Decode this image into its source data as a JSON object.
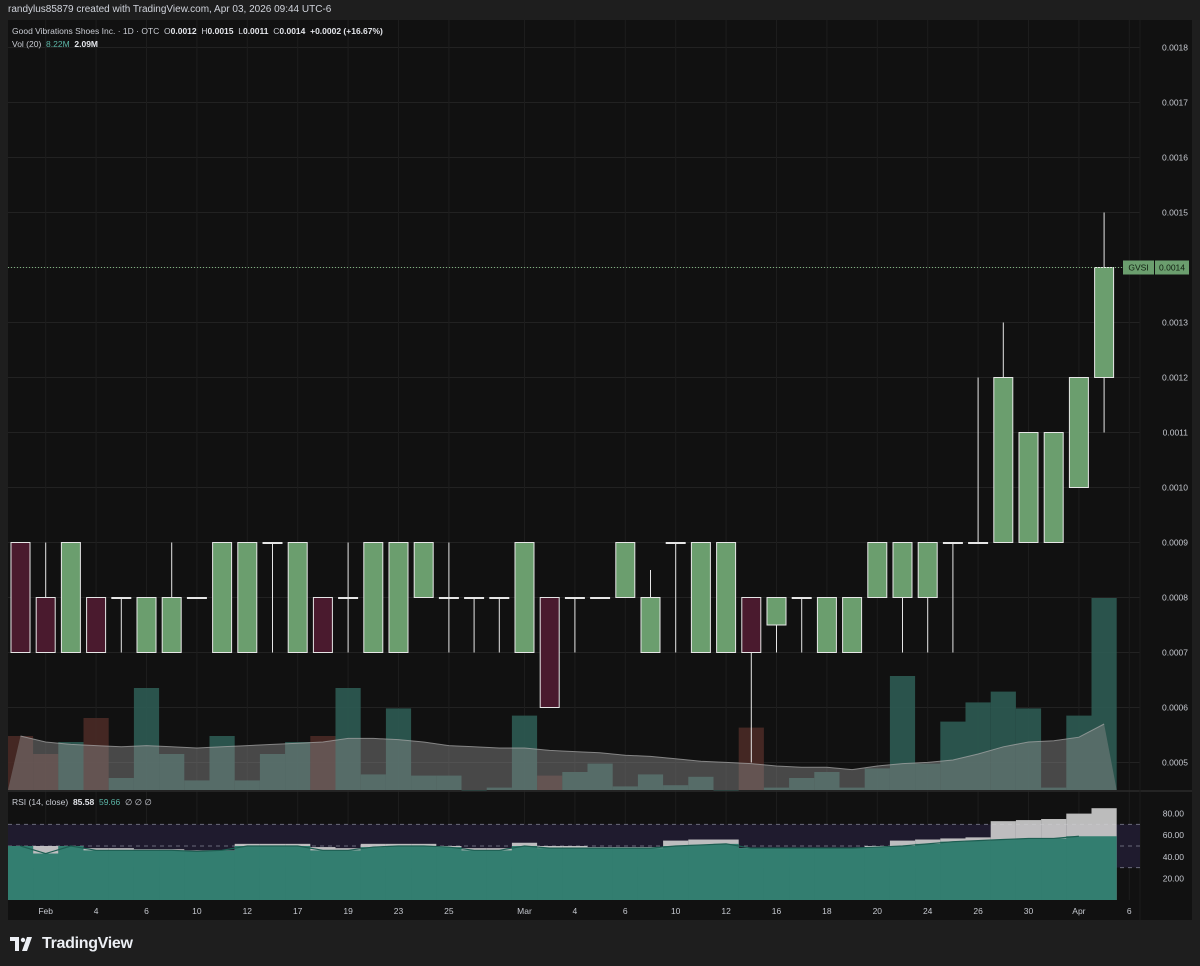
{
  "header": {
    "attribution": "randylus85879 created with TradingView.com, Apr 03, 2026 09:44 UTC-6"
  },
  "legend": {
    "symbol": "Good Vibrations Shoes Inc.",
    "interval_exchange": "· 1D · OTC",
    "o_label": "O",
    "o_value": "0.0012",
    "h_label": "H",
    "h_value": "0.0015",
    "l_label": "L",
    "l_value": "0.0011",
    "c_label": "C",
    "c_value": "0.0014",
    "change": "+0.0002 (+16.67%)",
    "vol_label": "Vol (20)",
    "vol_value_1": "8.22M",
    "vol_value_2": "2.09M",
    "rsi_label": "RSI (14, close)",
    "rsi_value": "85.58",
    "rsi_ma_value": "59.66",
    "rsi_extra": "∅ ∅ ∅"
  },
  "price_tag": {
    "ticker": "GVSI",
    "value": "0.0014"
  },
  "footer": {
    "brand": "TradingView"
  },
  "colors": {
    "up": "#6b9e6e",
    "down": "#4a1a2e",
    "vol_up": "#2e5b53",
    "vol_down": "#4a2a26",
    "vol_ma": "#8c8c8c",
    "rsi_fill": "#2b7a6b",
    "rsi_band": "#1f1b2e",
    "background": "#111111"
  },
  "chart_data": {
    "type": "candlestick",
    "y_axis_price": {
      "min": 0.00045,
      "max": 0.00185,
      "ticks": [
        "0.0018",
        "0.0017",
        "0.0016",
        "0.0015",
        "0.0014",
        "0.0013",
        "0.0012",
        "0.0011",
        "0.0010",
        "0.0009",
        "0.0008",
        "0.0007",
        "0.0006",
        "0.0005"
      ]
    },
    "y_axis_rsi": {
      "min": 0,
      "max": 100,
      "ticks": [
        "80.00",
        "60.00",
        "40.00",
        "20.00"
      ],
      "band": [
        30,
        70
      ],
      "midline": 50
    },
    "x_tick_labels": [
      {
        "i": 1,
        "label": "Feb"
      },
      {
        "i": 3,
        "label": "4"
      },
      {
        "i": 5,
        "label": "6"
      },
      {
        "i": 7,
        "label": "10"
      },
      {
        "i": 9,
        "label": "12"
      },
      {
        "i": 11,
        "label": "17"
      },
      {
        "i": 13,
        "label": "19"
      },
      {
        "i": 15,
        "label": "23"
      },
      {
        "i": 17,
        "label": "25"
      },
      {
        "i": 20,
        "label": "Mar"
      },
      {
        "i": 22,
        "label": "4"
      },
      {
        "i": 24,
        "label": "6"
      },
      {
        "i": 26,
        "label": "10"
      },
      {
        "i": 28,
        "label": "12"
      },
      {
        "i": 30,
        "label": "16"
      },
      {
        "i": 32,
        "label": "18"
      },
      {
        "i": 34,
        "label": "20"
      },
      {
        "i": 36,
        "label": "24"
      },
      {
        "i": 38,
        "label": "26"
      },
      {
        "i": 40,
        "label": "30"
      },
      {
        "i": 42,
        "label": "Apr"
      },
      {
        "i": 44,
        "label": "6"
      }
    ],
    "ohlc": [
      [
        0.0009,
        0.0009,
        0.0007,
        0.0007
      ],
      [
        0.0008,
        0.0009,
        0.0007,
        0.0007
      ],
      [
        0.0007,
        0.0009,
        0.0007,
        0.0009
      ],
      [
        0.0008,
        0.0008,
        0.0007,
        0.0007
      ],
      [
        0.0008,
        0.0008,
        0.0007,
        0.0008
      ],
      [
        0.0007,
        0.0008,
        0.0007,
        0.0008
      ],
      [
        0.0007,
        0.0009,
        0.0007,
        0.0008
      ],
      [
        0.0008,
        0.0008,
        0.0008,
        0.0008
      ],
      [
        0.0007,
        0.0009,
        0.0007,
        0.0009
      ],
      [
        0.0007,
        0.0009,
        0.0007,
        0.0009
      ],
      [
        0.0009,
        0.0009,
        0.0007,
        0.0009
      ],
      [
        0.0007,
        0.0009,
        0.0007,
        0.0009
      ],
      [
        0.0008,
        0.0008,
        0.0007,
        0.0007
      ],
      [
        0.0008,
        0.0009,
        0.0007,
        0.0008
      ],
      [
        0.0007,
        0.0009,
        0.0007,
        0.0009
      ],
      [
        0.0007,
        0.0009,
        0.0007,
        0.0009
      ],
      [
        0.0008,
        0.0009,
        0.0008,
        0.0009
      ],
      [
        0.0008,
        0.0009,
        0.0007,
        0.0008
      ],
      [
        0.0008,
        0.0008,
        0.0007,
        0.0008
      ],
      [
        0.0008,
        0.0008,
        0.0007,
        0.0008
      ],
      [
        0.0007,
        0.0009,
        0.0007,
        0.0009
      ],
      [
        0.0008,
        0.0008,
        0.0006,
        0.0006
      ],
      [
        0.0008,
        0.0008,
        0.0007,
        0.0008
      ],
      [
        0.0008,
        0.0008,
        0.0008,
        0.0008
      ],
      [
        0.0008,
        0.0009,
        0.0008,
        0.0009
      ],
      [
        0.0007,
        0.00085,
        0.0007,
        0.0008
      ],
      [
        0.0009,
        0.0009,
        0.0007,
        0.0009
      ],
      [
        0.0007,
        0.0009,
        0.0007,
        0.0009
      ],
      [
        0.0007,
        0.0009,
        0.0007,
        0.0009
      ],
      [
        0.0008,
        0.0008,
        0.0005,
        0.0007
      ],
      [
        0.00075,
        0.0008,
        0.0007,
        0.0008
      ],
      [
        0.0008,
        0.0008,
        0.0007,
        0.0008
      ],
      [
        0.0007,
        0.0008,
        0.0007,
        0.0008
      ],
      [
        0.0007,
        0.0008,
        0.0007,
        0.0008
      ],
      [
        0.0008,
        0.0009,
        0.0008,
        0.0009
      ],
      [
        0.0008,
        0.0009,
        0.0007,
        0.0009
      ],
      [
        0.0008,
        0.0009,
        0.0007,
        0.0009
      ],
      [
        0.0009,
        0.0009,
        0.0007,
        0.0009
      ],
      [
        0.0009,
        0.0012,
        0.0009,
        0.0009
      ],
      [
        0.0009,
        0.0013,
        0.0009,
        0.0012
      ],
      [
        0.0009,
        0.0011,
        0.0009,
        0.0011
      ],
      [
        0.0009,
        0.0011,
        0.0009,
        0.0011
      ],
      [
        0.001,
        0.0012,
        0.001,
        0.0012
      ],
      [
        0.0012,
        0.0015,
        0.0011,
        0.0014
      ]
    ],
    "volume_rel": [
      0.45,
      0.3,
      0.4,
      0.6,
      0.1,
      0.85,
      0.3,
      0.08,
      0.45,
      0.08,
      0.3,
      0.4,
      0.45,
      0.85,
      0.13,
      0.68,
      0.12,
      0.12,
      0.0,
      0.02,
      0.62,
      0.12,
      0.15,
      0.22,
      0.03,
      0.13,
      0.04,
      0.11,
      0.0,
      0.52,
      0.02,
      0.1,
      0.15,
      0.02,
      0.18,
      0.95,
      0.22,
      0.57,
      0.73,
      0.82,
      0.68,
      0.02,
      0.62,
      1.6
    ],
    "volume_ma_rel": [
      0.45,
      0.4,
      0.38,
      0.37,
      0.36,
      0.37,
      0.36,
      0.35,
      0.36,
      0.37,
      0.38,
      0.39,
      0.4,
      0.43,
      0.43,
      0.42,
      0.4,
      0.37,
      0.36,
      0.35,
      0.35,
      0.33,
      0.32,
      0.31,
      0.29,
      0.28,
      0.26,
      0.24,
      0.23,
      0.22,
      0.2,
      0.19,
      0.19,
      0.17,
      0.2,
      0.22,
      0.23,
      0.25,
      0.3,
      0.36,
      0.4,
      0.41,
      0.44,
      0.55
    ],
    "rsi": [
      50,
      43,
      50,
      46,
      46,
      46,
      46,
      45,
      46,
      50,
      50,
      50,
      46,
      46,
      49,
      50,
      50,
      49,
      46,
      46,
      50,
      48,
      48,
      48,
      48,
      48,
      50,
      51,
      52,
      48,
      48,
      48,
      48,
      48,
      49,
      50,
      52,
      54,
      55,
      56,
      57,
      57,
      59,
      85.58
    ],
    "rsi_ma": [
      50,
      50,
      50,
      48,
      48,
      47,
      47,
      46,
      46,
      52,
      52,
      52,
      49,
      48,
      52,
      52,
      52,
      50,
      48,
      48,
      53,
      50,
      50,
      49,
      49,
      49,
      55,
      56,
      56,
      48,
      48,
      48,
      48,
      48,
      50,
      55,
      56,
      57,
      58,
      73,
      74,
      75,
      80,
      85
    ]
  }
}
